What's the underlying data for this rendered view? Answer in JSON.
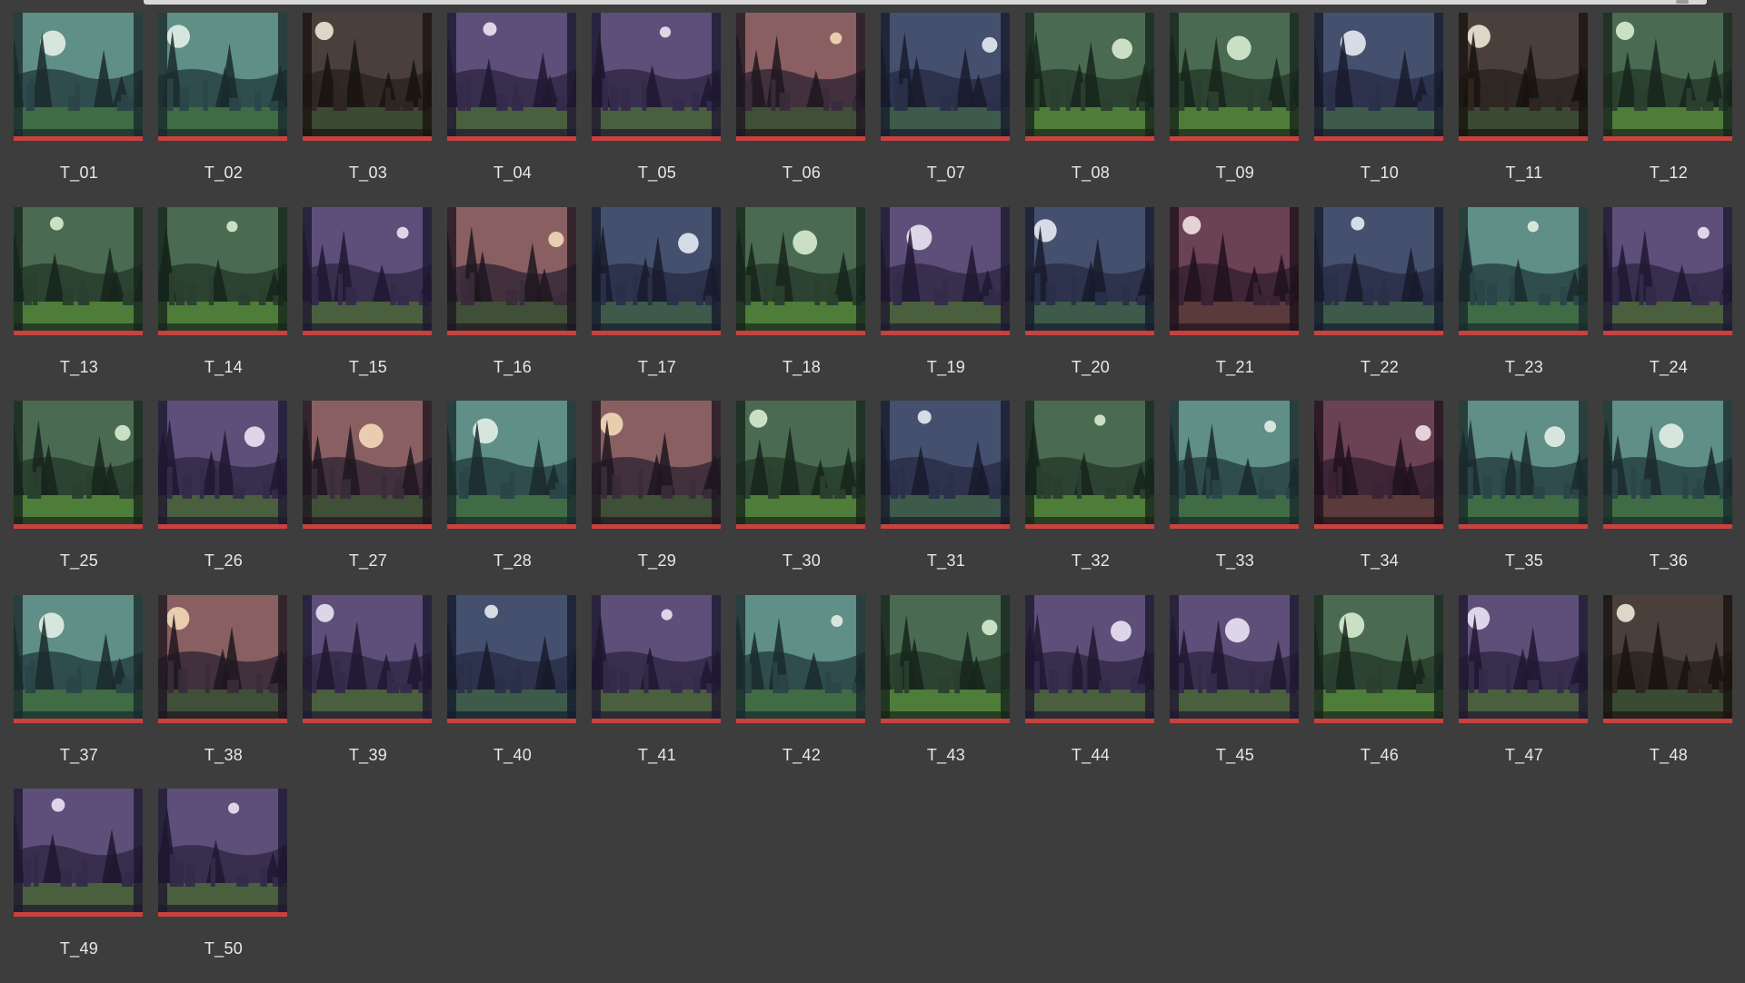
{
  "accent_color": "#c8423f",
  "assets": [
    {
      "label": "T_01",
      "palette": "teal"
    },
    {
      "label": "T_02",
      "palette": "teal"
    },
    {
      "label": "T_03",
      "palette": "brown"
    },
    {
      "label": "T_04",
      "palette": "purple"
    },
    {
      "label": "T_05",
      "palette": "purple"
    },
    {
      "label": "T_06",
      "palette": "dusk"
    },
    {
      "label": "T_07",
      "palette": "blue"
    },
    {
      "label": "T_08",
      "palette": "green"
    },
    {
      "label": "T_09",
      "palette": "green"
    },
    {
      "label": "T_10",
      "palette": "blue"
    },
    {
      "label": "T_11",
      "palette": "brown"
    },
    {
      "label": "T_12",
      "palette": "green"
    },
    {
      "label": "T_13",
      "palette": "green"
    },
    {
      "label": "T_14",
      "palette": "green"
    },
    {
      "label": "T_15",
      "palette": "purple"
    },
    {
      "label": "T_16",
      "palette": "dusk"
    },
    {
      "label": "T_17",
      "palette": "blue"
    },
    {
      "label": "T_18",
      "palette": "green"
    },
    {
      "label": "T_19",
      "palette": "purple"
    },
    {
      "label": "T_20",
      "palette": "blue"
    },
    {
      "label": "T_21",
      "palette": "red"
    },
    {
      "label": "T_22",
      "palette": "blue"
    },
    {
      "label": "T_23",
      "palette": "teal"
    },
    {
      "label": "T_24",
      "palette": "purple"
    },
    {
      "label": "T_25",
      "palette": "green"
    },
    {
      "label": "T_26",
      "palette": "purple"
    },
    {
      "label": "T_27",
      "palette": "dusk"
    },
    {
      "label": "T_28",
      "palette": "teal"
    },
    {
      "label": "T_29",
      "palette": "dusk"
    },
    {
      "label": "T_30",
      "palette": "green"
    },
    {
      "label": "T_31",
      "palette": "blue"
    },
    {
      "label": "T_32",
      "palette": "green"
    },
    {
      "label": "T_33",
      "palette": "teal"
    },
    {
      "label": "T_34",
      "palette": "red"
    },
    {
      "label": "T_35",
      "palette": "teal"
    },
    {
      "label": "T_36",
      "palette": "teal"
    },
    {
      "label": "T_37",
      "palette": "teal"
    },
    {
      "label": "T_38",
      "palette": "dusk"
    },
    {
      "label": "T_39",
      "palette": "purple"
    },
    {
      "label": "T_40",
      "palette": "blue"
    },
    {
      "label": "T_41",
      "palette": "purple"
    },
    {
      "label": "T_42",
      "palette": "teal"
    },
    {
      "label": "T_43",
      "palette": "green"
    },
    {
      "label": "T_44",
      "palette": "purple"
    },
    {
      "label": "T_45",
      "palette": "purple"
    },
    {
      "label": "T_46",
      "palette": "green"
    },
    {
      "label": "T_47",
      "palette": "purple"
    },
    {
      "label": "T_48",
      "palette": "brown"
    },
    {
      "label": "T_49",
      "palette": "purple"
    },
    {
      "label": "T_50",
      "palette": "purple"
    }
  ],
  "palettes": {
    "teal": {
      "sky": "#5f8f86",
      "moon": "#e3efe6",
      "far": "#2b4648",
      "near": "#1a2a2c",
      "ground": "#3f6b45"
    },
    "green": {
      "sky": "#4a6b52",
      "moon": "#d8ecd0",
      "far": "#2a3f2e",
      "near": "#17251b",
      "ground": "#4e7d3a"
    },
    "purple": {
      "sky": "#5d4f7a",
      "moon": "#eae4f4",
      "far": "#342b4a",
      "near": "#1e1830",
      "ground": "#4a5f3e"
    },
    "blue": {
      "sky": "#45506f",
      "moon": "#e6ebf2",
      "far": "#2a3049",
      "near": "#171b2c",
      "ground": "#3d5a4a"
    },
    "dusk": {
      "sky": "#8a5f62",
      "moon": "#f3d9b8",
      "far": "#3a2c3a",
      "near": "#1e1620",
      "ground": "#405038"
    },
    "brown": {
      "sky": "#4a3f3a",
      "moon": "#efe7d8",
      "far": "#2e2622",
      "near": "#18130f",
      "ground": "#3b4a33"
    },
    "red": {
      "sky": "#6b4154",
      "moon": "#f2e2e6",
      "far": "#3a2334",
      "near": "#1f121c",
      "ground": "#5a3a3a"
    }
  }
}
